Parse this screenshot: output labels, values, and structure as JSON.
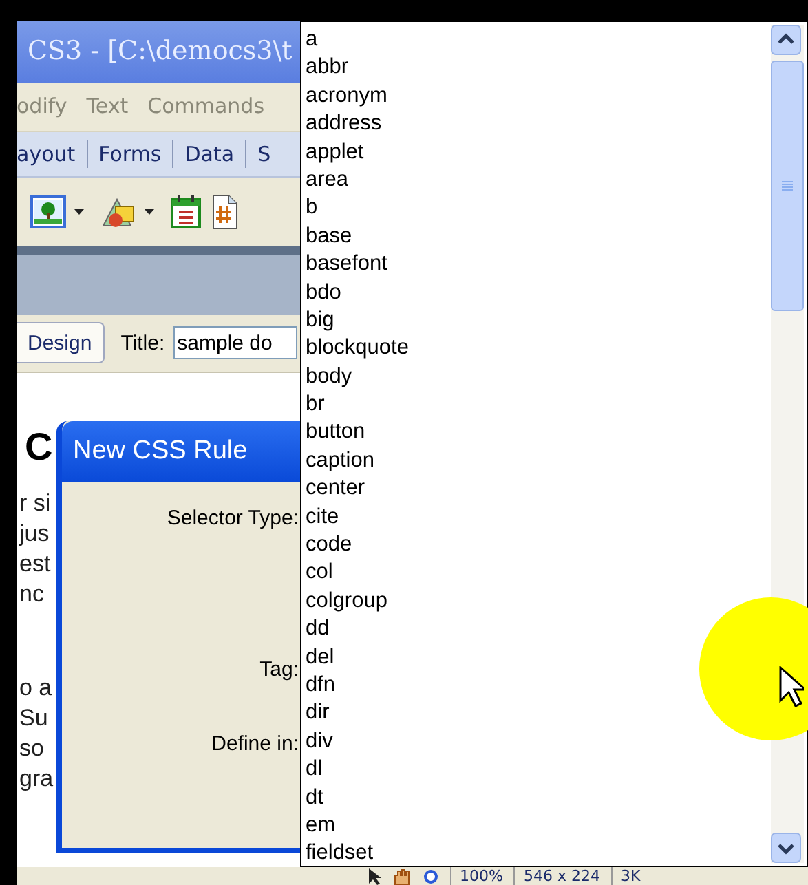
{
  "window": {
    "title": "CS3 - [C:\\democs3\\t"
  },
  "menu": [
    "odify",
    "Text",
    "Commands"
  ],
  "insert_tabs": [
    "ayout",
    "Forms",
    "Data",
    "S"
  ],
  "doc_toolbar": {
    "view_button": "Design",
    "title_label": "Title:",
    "title_value": "sample do"
  },
  "document": {
    "heading": "C",
    "paragraphs": [
      [
        "r si",
        "jus",
        "est",
        "nc"
      ],
      [
        "o a",
        "Su",
        "so",
        "gra"
      ]
    ]
  },
  "dialog": {
    "title": "New CSS Rule",
    "labels": [
      {
        "text": "Selector Type:",
        "kind": "top"
      },
      {
        "text": "Tag:",
        "kind": "middle"
      },
      {
        "text": "Define in:",
        "kind": "bottom"
      }
    ]
  },
  "tag_list": {
    "items": [
      "a",
      "abbr",
      "acronym",
      "address",
      "applet",
      "area",
      "b",
      "base",
      "basefont",
      "bdo",
      "big",
      "blockquote",
      "body",
      "br",
      "button",
      "caption",
      "center",
      "cite",
      "code",
      "col",
      "colgroup",
      "dd",
      "del",
      "dfn",
      "dir",
      "div",
      "dl",
      "dt",
      "em",
      "fieldset"
    ]
  },
  "status_bar": {
    "zoom": "100%",
    "size": "546 x 224",
    "weight": "3K"
  }
}
